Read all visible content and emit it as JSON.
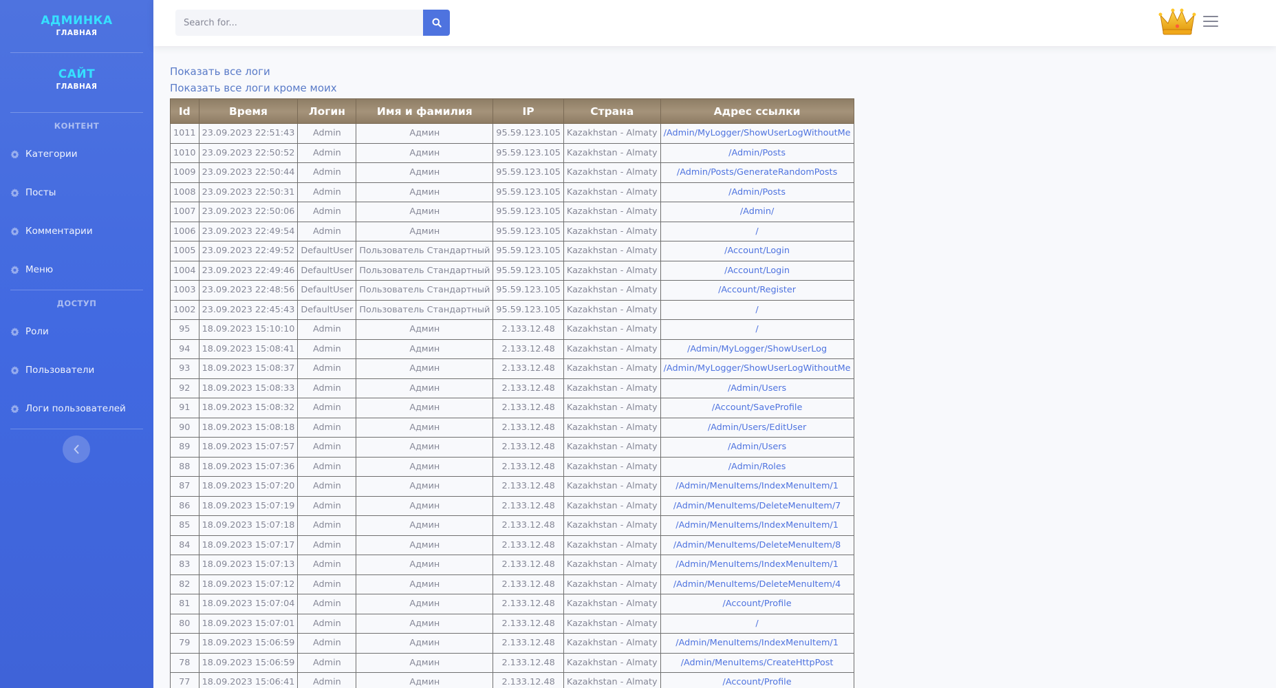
{
  "sidebar": {
    "brand": {
      "title": "АДМИНКА",
      "subtitle": "ГЛАВНАЯ"
    },
    "site": {
      "title": "САЙТ",
      "subtitle": "ГЛАВНАЯ"
    },
    "heading_content": "КОНТЕНТ",
    "heading_access": "ДОСТУП",
    "content_items": [
      {
        "label": "Категории",
        "icon": "gear-icon"
      },
      {
        "label": "Посты",
        "icon": "gear-icon"
      },
      {
        "label": "Комментарии",
        "icon": "gear-icon"
      },
      {
        "label": "Меню",
        "icon": "gear-icon"
      }
    ],
    "access_items": [
      {
        "label": "Роли",
        "icon": "gear-icon"
      },
      {
        "label": "Пользователи",
        "icon": "gear-icon"
      },
      {
        "label": "Логи пользователей",
        "icon": "gear-icon"
      }
    ],
    "toggle_icon": "chevron-left-icon"
  },
  "topbar": {
    "search_placeholder": "Search for...",
    "search_icon": "search-icon",
    "avatar_icon": "crown-icon",
    "menu_icon": "hamburger-icon"
  },
  "links": {
    "show_all": "Показать все логи",
    "show_all_except_mine": "Показать все логи кроме моих"
  },
  "table": {
    "headers": [
      "Id",
      "Время",
      "Логин",
      "Имя и фамилия",
      "IP",
      "Страна",
      "Адрес ссылки"
    ],
    "rows": [
      [
        "1011",
        "23.09.2023 22:51:43",
        "Admin",
        "Админ",
        "95.59.123.105",
        "Kazakhstan - Almaty",
        "/Admin/MyLogger/ShowUserLogWithoutMe"
      ],
      [
        "1010",
        "23.09.2023 22:50:52",
        "Admin",
        "Админ",
        "95.59.123.105",
        "Kazakhstan - Almaty",
        "/Admin/Posts"
      ],
      [
        "1009",
        "23.09.2023 22:50:44",
        "Admin",
        "Админ",
        "95.59.123.105",
        "Kazakhstan - Almaty",
        "/Admin/Posts/GenerateRandomPosts"
      ],
      [
        "1008",
        "23.09.2023 22:50:31",
        "Admin",
        "Админ",
        "95.59.123.105",
        "Kazakhstan - Almaty",
        "/Admin/Posts"
      ],
      [
        "1007",
        "23.09.2023 22:50:06",
        "Admin",
        "Админ",
        "95.59.123.105",
        "Kazakhstan - Almaty",
        "/Admin/"
      ],
      [
        "1006",
        "23.09.2023 22:49:54",
        "Admin",
        "Админ",
        "95.59.123.105",
        "Kazakhstan - Almaty",
        "/"
      ],
      [
        "1005",
        "23.09.2023 22:49:52",
        "DefaultUser",
        "Пользователь Стандартный",
        "95.59.123.105",
        "Kazakhstan - Almaty",
        "/Account/Login"
      ],
      [
        "1004",
        "23.09.2023 22:49:46",
        "DefaultUser",
        "Пользователь Стандартный",
        "95.59.123.105",
        "Kazakhstan - Almaty",
        "/Account/Login"
      ],
      [
        "1003",
        "23.09.2023 22:48:56",
        "DefaultUser",
        "Пользователь Стандартный",
        "95.59.123.105",
        "Kazakhstan - Almaty",
        "/Account/Register"
      ],
      [
        "1002",
        "23.09.2023 22:45:43",
        "DefaultUser",
        "Пользователь Стандартный",
        "95.59.123.105",
        "Kazakhstan - Almaty",
        "/"
      ],
      [
        "95",
        "18.09.2023 15:10:10",
        "Admin",
        "Админ",
        "2.133.12.48",
        "Kazakhstan - Almaty",
        "/"
      ],
      [
        "94",
        "18.09.2023 15:08:41",
        "Admin",
        "Админ",
        "2.133.12.48",
        "Kazakhstan - Almaty",
        "/Admin/MyLogger/ShowUserLog"
      ],
      [
        "93",
        "18.09.2023 15:08:37",
        "Admin",
        "Админ",
        "2.133.12.48",
        "Kazakhstan - Almaty",
        "/Admin/MyLogger/ShowUserLogWithoutMe"
      ],
      [
        "92",
        "18.09.2023 15:08:33",
        "Admin",
        "Админ",
        "2.133.12.48",
        "Kazakhstan - Almaty",
        "/Admin/Users"
      ],
      [
        "91",
        "18.09.2023 15:08:32",
        "Admin",
        "Админ",
        "2.133.12.48",
        "Kazakhstan - Almaty",
        "/Account/SaveProfile"
      ],
      [
        "90",
        "18.09.2023 15:08:18",
        "Admin",
        "Админ",
        "2.133.12.48",
        "Kazakhstan - Almaty",
        "/Admin/Users/EditUser"
      ],
      [
        "89",
        "18.09.2023 15:07:57",
        "Admin",
        "Админ",
        "2.133.12.48",
        "Kazakhstan - Almaty",
        "/Admin/Users"
      ],
      [
        "88",
        "18.09.2023 15:07:36",
        "Admin",
        "Админ",
        "2.133.12.48",
        "Kazakhstan - Almaty",
        "/Admin/Roles"
      ],
      [
        "87",
        "18.09.2023 15:07:20",
        "Admin",
        "Админ",
        "2.133.12.48",
        "Kazakhstan - Almaty",
        "/Admin/MenuItems/IndexMenuItem/1"
      ],
      [
        "86",
        "18.09.2023 15:07:19",
        "Admin",
        "Админ",
        "2.133.12.48",
        "Kazakhstan - Almaty",
        "/Admin/MenuItems/DeleteMenuItem/7"
      ],
      [
        "85",
        "18.09.2023 15:07:18",
        "Admin",
        "Админ",
        "2.133.12.48",
        "Kazakhstan - Almaty",
        "/Admin/MenuItems/IndexMenuItem/1"
      ],
      [
        "84",
        "18.09.2023 15:07:17",
        "Admin",
        "Админ",
        "2.133.12.48",
        "Kazakhstan - Almaty",
        "/Admin/MenuItems/DeleteMenuItem/8"
      ],
      [
        "83",
        "18.09.2023 15:07:13",
        "Admin",
        "Админ",
        "2.133.12.48",
        "Kazakhstan - Almaty",
        "/Admin/MenuItems/IndexMenuItem/1"
      ],
      [
        "82",
        "18.09.2023 15:07:12",
        "Admin",
        "Админ",
        "2.133.12.48",
        "Kazakhstan - Almaty",
        "/Admin/MenuItems/DeleteMenuItem/4"
      ],
      [
        "81",
        "18.09.2023 15:07:04",
        "Admin",
        "Админ",
        "2.133.12.48",
        "Kazakhstan - Almaty",
        "/Account/Profile"
      ],
      [
        "80",
        "18.09.2023 15:07:01",
        "Admin",
        "Админ",
        "2.133.12.48",
        "Kazakhstan - Almaty",
        "/"
      ],
      [
        "79",
        "18.09.2023 15:06:59",
        "Admin",
        "Админ",
        "2.133.12.48",
        "Kazakhstan - Almaty",
        "/Admin/MenuItems/IndexMenuItem/1"
      ],
      [
        "78",
        "18.09.2023 15:06:59",
        "Admin",
        "Админ",
        "2.133.12.48",
        "Kazakhstan - Almaty",
        "/Admin/MenuItems/CreateHttpPost"
      ],
      [
        "77",
        "18.09.2023 15:06:41",
        "Admin",
        "Админ",
        "2.133.12.48",
        "Kazakhstan - Almaty",
        "/Account/Profile"
      ]
    ]
  }
}
